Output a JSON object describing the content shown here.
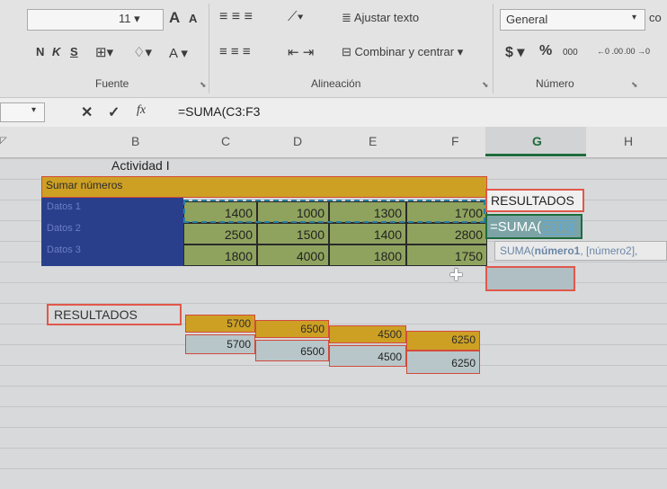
{
  "ribbon": {
    "font_size": "11",
    "grow_font": "A",
    "shrink_font": "A",
    "bold": "N",
    "italic": "K",
    "underline": "S",
    "font_color_letter": "A",
    "wrap_text_label": "Ajustar texto",
    "merge_center_label": "Combinar y centrar",
    "number_format": "General",
    "currency_symbol": "$",
    "percent_symbol": "%",
    "thousands_label": "000",
    "dec_inc": "←0 .00",
    "dec_dec": ".00 →0",
    "styles_cut": "co",
    "groups": {
      "font": "Fuente",
      "alignment": "Alineación",
      "number": "Número"
    }
  },
  "formula_bar": {
    "cancel": "✕",
    "enter": "✓",
    "fx": "fx",
    "content": "=SUMA(C3:F3"
  },
  "columns": [
    "B",
    "C",
    "D",
    "E",
    "F",
    "G",
    "H"
  ],
  "sheet": {
    "title": "Actividad I",
    "header_band": "Sumar números",
    "row_labels": [
      "Datos 1",
      "Datos 2",
      "Datos 3"
    ],
    "data": [
      [
        1400,
        1000,
        1300,
        1700
      ],
      [
        2500,
        1500,
        1400,
        2800
      ],
      [
        1800,
        4000,
        1800,
        1750
      ]
    ],
    "results_header": "RESULTADOS",
    "active_cell_text": "=SUMA(",
    "active_cell_ref": "C3:F3",
    "tooltip_fn": "SUMA(",
    "tooltip_arg1": "número1",
    "tooltip_rest": ", [número2],",
    "results_label": "RESULTADOS",
    "sum_row_1": [
      5700,
      6500,
      4500,
      6250
    ],
    "sum_row_2": [
      5700,
      6500,
      4500,
      6250
    ]
  },
  "colors": {
    "green": "#8fa35e",
    "blue": "#2a3f8c",
    "amber": "#cda024",
    "excel_green": "#1f6b3d"
  }
}
